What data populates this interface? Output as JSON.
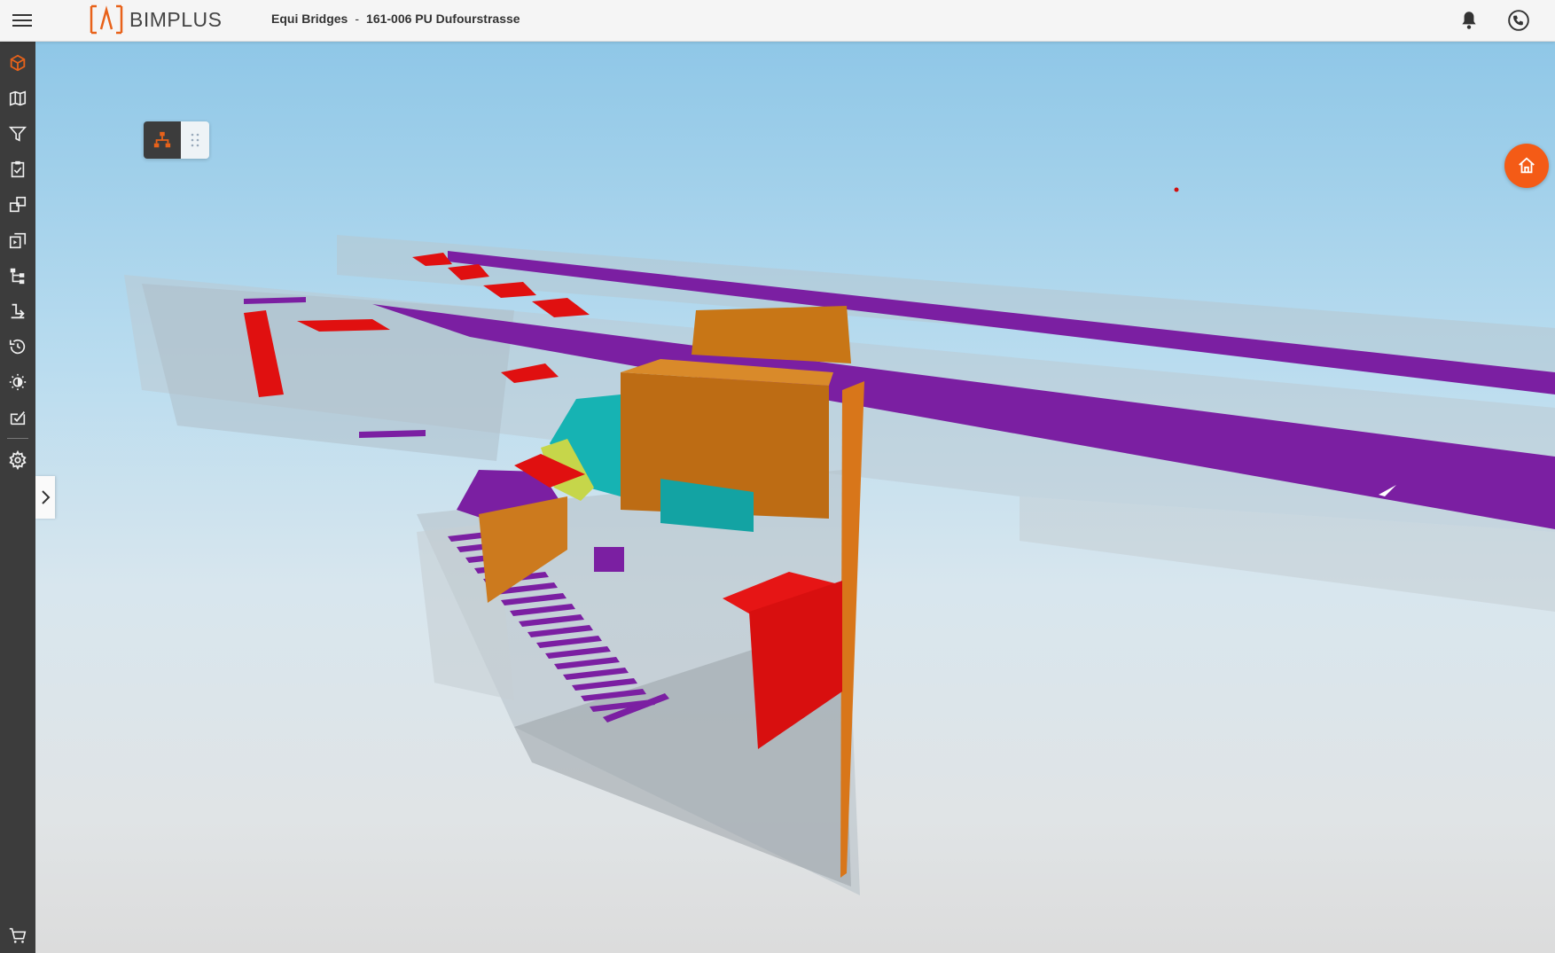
{
  "app": {
    "logo_text": "BIMPLUS",
    "brand_color": "#e8621a"
  },
  "header": {
    "team": "Equi Bridges",
    "separator": "-",
    "project": "161-006 PU Dufourstrasse",
    "icons": [
      "menu-icon",
      "bell-icon",
      "phone-icon"
    ]
  },
  "sidebar": {
    "items": [
      {
        "icon": "model-cube-icon",
        "active": true
      },
      {
        "icon": "map-icon"
      },
      {
        "icon": "filter-icon"
      },
      {
        "icon": "clipboard-check-icon"
      },
      {
        "icon": "compare-icon"
      },
      {
        "icon": "revision-icon"
      },
      {
        "icon": "hierarchy-icon"
      },
      {
        "icon": "import-icon"
      },
      {
        "icon": "history-icon"
      },
      {
        "icon": "brightness-icon"
      },
      {
        "icon": "checklist-icon"
      },
      {
        "icon": "settings-icon"
      },
      {
        "icon": "cart-icon"
      }
    ],
    "bg_color": "#3c3c3c",
    "active_color": "#e8621a"
  },
  "viewer": {
    "toggle_icons": [
      "structure-tree-icon",
      "grid-dots-icon"
    ],
    "home_button_color": "#f45b16",
    "model_colors": {
      "slab": "#7b1fa2",
      "wall_orange": "#c46a10",
      "wall_red": "#e01010",
      "cyan": "#1ab0b0",
      "yellow": "#c8d840",
      "transparent_concrete": "#b4c0c8"
    }
  }
}
